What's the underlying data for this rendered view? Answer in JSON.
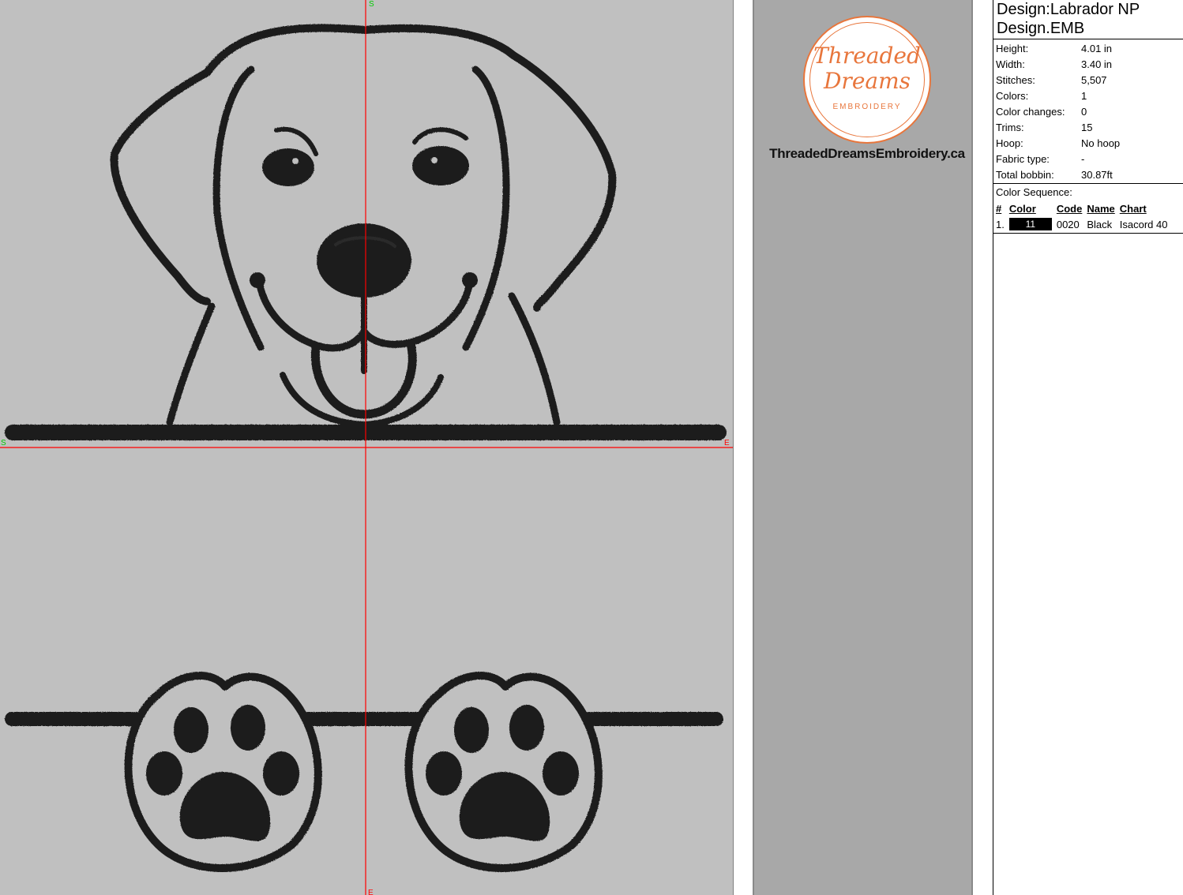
{
  "canvas": {
    "markers": {
      "start_top": "S",
      "start_left": "S",
      "end_right": "E",
      "end_bottom": "E"
    }
  },
  "logo": {
    "script_line1": "Threaded",
    "script_line2": "Dreams",
    "subtitle": "EMBROIDERY",
    "url": "ThreadedDreamsEmbroidery.ca"
  },
  "info": {
    "title_line1": "Design:Labrador NP",
    "title_line2": "Design.EMB",
    "properties": [
      {
        "key": "Height:",
        "value": "4.01 in"
      },
      {
        "key": "Width:",
        "value": "3.40 in"
      },
      {
        "key": "Stitches:",
        "value": "5,507"
      },
      {
        "key": "Colors:",
        "value": "1"
      },
      {
        "key": "Color changes:",
        "value": "0"
      },
      {
        "key": "Trims:",
        "value": "15"
      },
      {
        "key": "Hoop:",
        "value": "No hoop"
      },
      {
        "key": "Fabric type:",
        "value": "-"
      },
      {
        "key": "Total bobbin:",
        "value": "30.87ft"
      }
    ],
    "sequence_label": "Color Sequence:",
    "sequence_headers": [
      "#",
      "Color",
      "Code",
      "Name",
      "Chart"
    ],
    "sequence": [
      {
        "num": "1.",
        "color_label": "11",
        "color_hex": "#000000",
        "code": "0020",
        "name": "Black",
        "chart": "Isacord 40"
      }
    ]
  },
  "colors": {
    "canvas_bg": "#c0c0c0",
    "thread": "#1e1e1e",
    "guide": "#ff0000",
    "logo_accent": "#e8763c"
  }
}
